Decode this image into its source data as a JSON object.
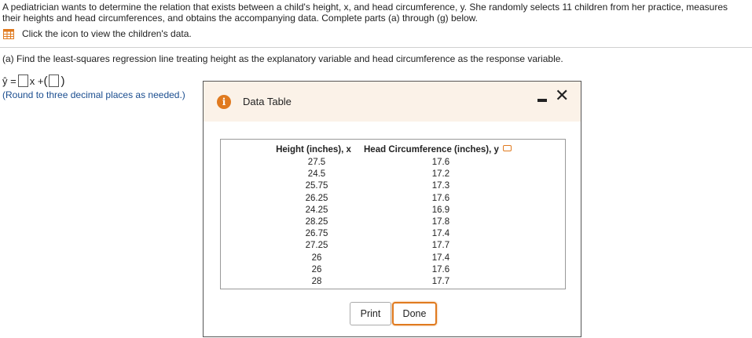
{
  "problem": {
    "text": "A pediatrician wants to determine the relation that exists between a child's height, x, and head circumference, y. She randomly selects 11 children from her practice, measures their heights and head circumferences, and obtains the accompanying data. Complete parts (a) through (g) below.",
    "data_link_label": "Click the icon to view the children's data."
  },
  "part_a": {
    "prompt": "(a) Find the least-squares regression line treating height as the explanatory variable and head circumference as the response variable.",
    "yhat": "ŷ =",
    "x_plus": "x +",
    "open_paren": "(",
    "close_paren": ")",
    "note": "(Round to three decimal places as needed.)"
  },
  "dialog": {
    "title": "Data Table",
    "info_glyph": "i",
    "close_glyph": "✕",
    "columns": [
      "Height (inches), x",
      "Head Circumference (inches), y"
    ],
    "rows": [
      [
        "27.5",
        "17.6"
      ],
      [
        "24.5",
        "17.2"
      ],
      [
        "25.75",
        "17.3"
      ],
      [
        "26.25",
        "17.6"
      ],
      [
        "24.25",
        "16.9"
      ],
      [
        "28.25",
        "17.8"
      ],
      [
        "26.75",
        "17.4"
      ],
      [
        "27.25",
        "17.7"
      ],
      [
        "26",
        "17.4"
      ],
      [
        "26",
        "17.6"
      ],
      [
        "28",
        "17.7"
      ]
    ],
    "print_label": "Print",
    "done_label": "Done"
  },
  "colors": {
    "accent": "#e07a1f",
    "header_bg": "#fbf2e8",
    "note_blue": "#1a4d8f",
    "grid_icon": "#e07a1f"
  }
}
